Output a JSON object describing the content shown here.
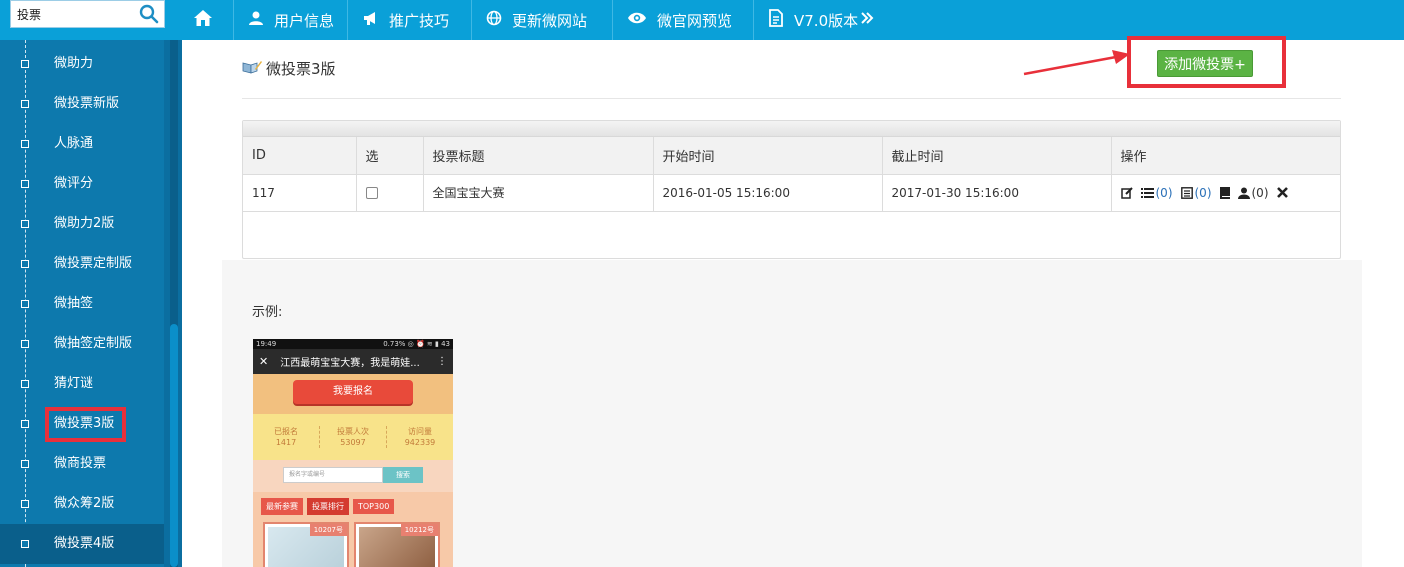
{
  "search": {
    "value": "投票"
  },
  "nav": [
    {
      "label": "用户信息",
      "icon": "user-icon"
    },
    {
      "label": "推广技巧",
      "icon": "megaphone-icon"
    },
    {
      "label": "更新微网站",
      "icon": "globe-icon"
    },
    {
      "label": "微官网预览",
      "icon": "eye-icon"
    },
    {
      "label": "V7.0版本",
      "icon": "document-icon"
    }
  ],
  "sidebar": {
    "items": [
      {
        "label": "微助力"
      },
      {
        "label": "微投票新版"
      },
      {
        "label": "人脉通"
      },
      {
        "label": "微评分"
      },
      {
        "label": "微助力2版"
      },
      {
        "label": "微投票定制版"
      },
      {
        "label": "微抽签"
      },
      {
        "label": "微抽签定制版"
      },
      {
        "label": "猜灯谜"
      },
      {
        "label": "微投票3版"
      },
      {
        "label": "微商投票"
      },
      {
        "label": "微众筹2版"
      },
      {
        "label": "微投票4版"
      }
    ]
  },
  "page": {
    "title": "微投票3版",
    "add_button": "添加微投票+",
    "example_label": "示例:"
  },
  "table": {
    "headers": [
      "ID",
      "选",
      "投票标题",
      "开始时间",
      "截止时间",
      "操作"
    ],
    "rows": [
      {
        "id": "117",
        "title": "全国宝宝大赛",
        "start": "2016-01-05 15:16:00",
        "end": "2017-01-30 15:16:00",
        "ops": {
          "list_count": "(0)",
          "detail_count": "(0)",
          "user_count": "(0)"
        }
      }
    ]
  },
  "phone": {
    "status_time": "19:49",
    "status_right": "0.73% ◎ ⏰ ≋ ▮ 43",
    "header_title": "江西最萌宝宝大赛，我是萌娃...",
    "signup": "我要报名",
    "stats": [
      {
        "label": "已报名",
        "value": "1417"
      },
      {
        "label": "投票人次",
        "value": "53097"
      },
      {
        "label": "访问量",
        "value": "942339"
      }
    ],
    "search_placeholder": "报名字或编号",
    "search_button": "搜索",
    "tabs": [
      "最新参赛",
      "投票排行",
      "TOP300"
    ],
    "cards": [
      "10207号",
      "10212号"
    ]
  },
  "colors": {
    "topbar": "#0aa0d8",
    "sidebar": "#0d79ad",
    "accent_red": "#e8303a",
    "add_green": "#5bb344"
  }
}
